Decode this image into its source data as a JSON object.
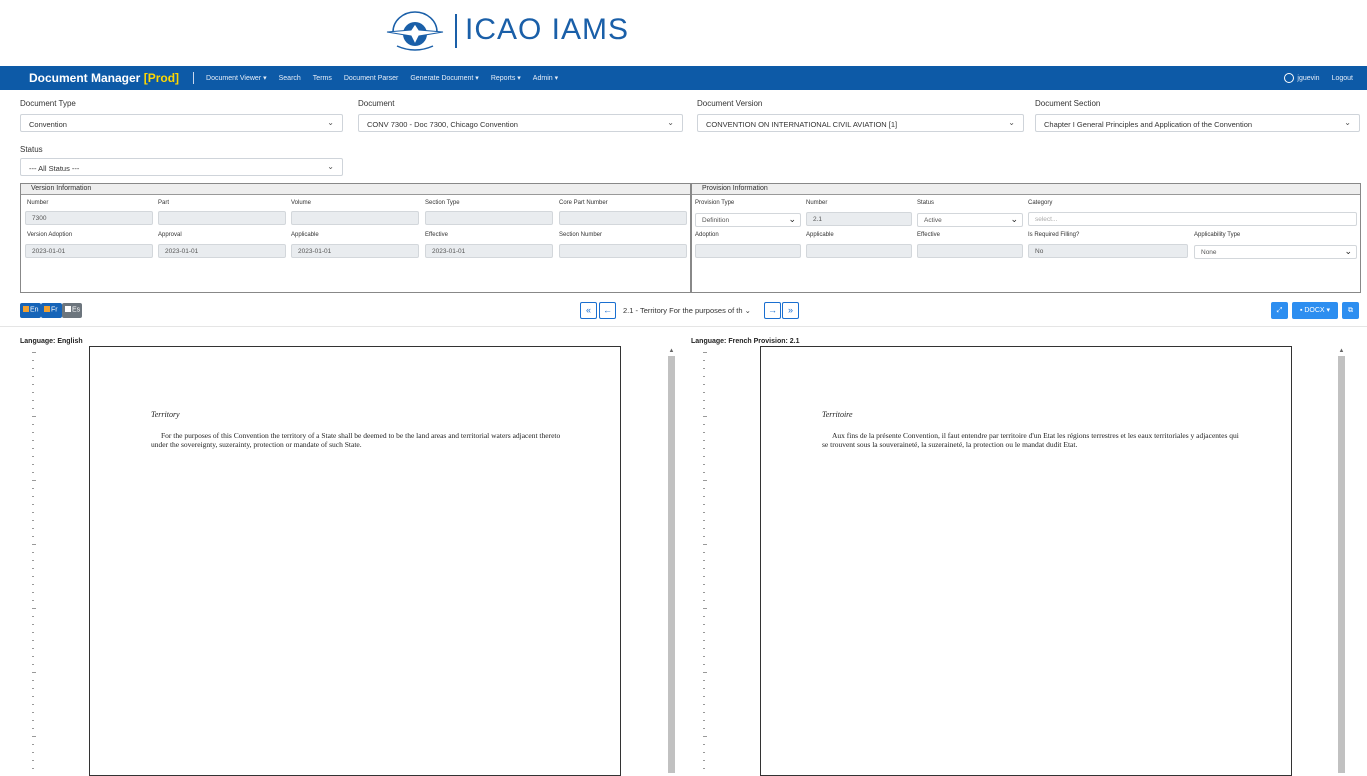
{
  "header": {
    "logo_text": "ICAO  IAMS"
  },
  "navbar": {
    "brand": "Document Manager",
    "env": "[Prod]",
    "items": [
      "Document Viewer ▾",
      "Search",
      "Terms",
      "Document Parser",
      "Generate Document ▾",
      "Reports ▾",
      "Admin ▾"
    ],
    "user": "jguevin",
    "logout": "Logout"
  },
  "filters": {
    "document_type": {
      "label": "Document Type",
      "value": "Convention"
    },
    "document": {
      "label": "Document",
      "value": "CONV 7300 - Doc 7300, Chicago Convention"
    },
    "document_version": {
      "label": "Document Version",
      "value": "CONVENTION ON INTERNATIONAL CIVIL AVIATION [1]"
    },
    "document_section": {
      "label": "Document Section",
      "value": "Chapter I General Principles and Application of the Convention"
    },
    "status": {
      "label": "Status",
      "value": "--- All Status ---"
    }
  },
  "version_info": {
    "title": "Version Information",
    "number": {
      "label": "Number",
      "value": "7300"
    },
    "part": {
      "label": "Part",
      "value": ""
    },
    "volume": {
      "label": "Volume",
      "value": ""
    },
    "section_type": {
      "label": "Section Type",
      "value": ""
    },
    "core_part_number": {
      "label": "Core Part Number",
      "value": ""
    },
    "version_adoption": {
      "label": "Version Adoption",
      "value": "2023-01-01"
    },
    "approval": {
      "label": "Approval",
      "value": "2023-01-01"
    },
    "applicable": {
      "label": "Applicable",
      "value": "2023-01-01"
    },
    "effective": {
      "label": "Effective",
      "value": "2023-01-01"
    },
    "section_number": {
      "label": "Section Number",
      "value": ""
    }
  },
  "provision_info": {
    "title": "Provision Information",
    "provision_type": {
      "label": "Provision Type",
      "value": "Definition"
    },
    "number": {
      "label": "Number",
      "value": "2.1"
    },
    "status": {
      "label": "Status",
      "value": "Active"
    },
    "category": {
      "label": "Category",
      "placeholder": "select..."
    },
    "adoption": {
      "label": "Adoption",
      "value": ""
    },
    "applicable": {
      "label": "Applicable",
      "value": ""
    },
    "effective": {
      "label": "Effective",
      "value": ""
    },
    "is_required_filing": {
      "label": "Is Required Filling?",
      "value": "No"
    },
    "applicability_type": {
      "label": "Applicability Type",
      "value": "None"
    }
  },
  "toolbar": {
    "lang_en": "En",
    "lang_fr": "Fr",
    "lang_es": "Es",
    "first": "«",
    "prev": "←",
    "current_provision": "2.1 - Territory For the purposes of th",
    "next": "→",
    "last": "»",
    "export_label": "DOCX ▾"
  },
  "viewers": {
    "left": {
      "title": "Language: English",
      "heading": "Territory",
      "body": "For the purposes of this Convention the territory of a State shall be deemed to be the land areas and territorial waters adjacent thereto under the sovereignty, suzerainty, protection or mandate of such State."
    },
    "right": {
      "title": "Language: French Provision: 2.1",
      "heading": "Territoire",
      "body": "Aux fins de la présente Convention, il faut entendre par territoire d'un Etat les régions terrestres et les eaux territoriales y adjacentes qui se trouvent sous la souveraineté, la suzeraineté, la protection ou le mandat dudit Etat."
    }
  }
}
